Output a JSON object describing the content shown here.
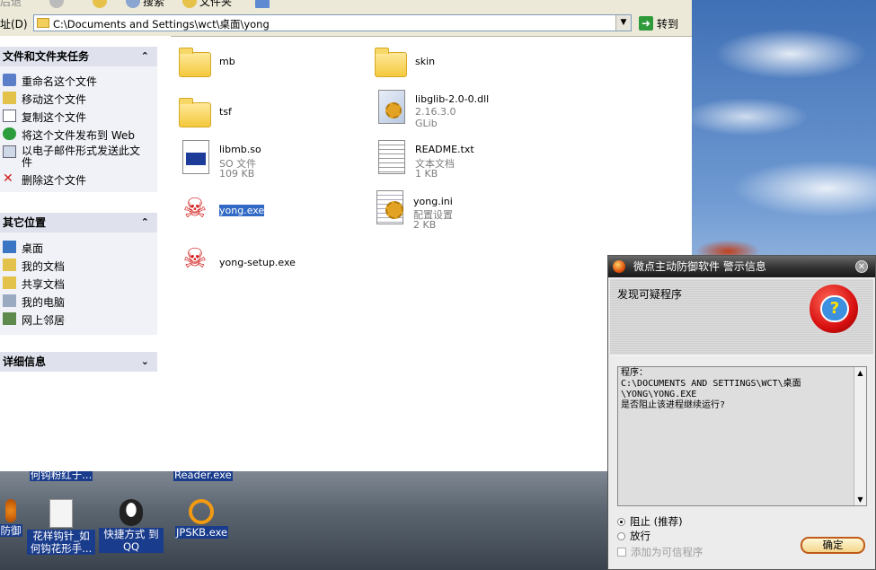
{
  "toolbar": {
    "back": "后退",
    "search": "搜索",
    "folders": "文件夹"
  },
  "address": {
    "label": "址(D)",
    "path": "C:\\Documents and Settings\\wct\\桌面\\yong",
    "go": "转到"
  },
  "taskpane": {
    "file_tasks": {
      "title": "文件和文件夹任务",
      "items": [
        "重命名这个文件",
        "移动这个文件",
        "复制这个文件",
        "将这个文件发布到 Web",
        "以电子邮件形式发送此文件",
        "删除这个文件"
      ]
    },
    "other_places": {
      "title": "其它位置",
      "items": [
        "桌面",
        "我的文档",
        "共享文档",
        "我的电脑",
        "网上邻居"
      ]
    },
    "details": {
      "title": "详细信息"
    }
  },
  "files": [
    {
      "name": "mb",
      "type": "folder"
    },
    {
      "name": "skin",
      "type": "folder"
    },
    {
      "name": "tsf",
      "type": "folder"
    },
    {
      "name": "libglib-2.0-0.dll",
      "line2": "2.16.3.0",
      "line3": "GLib",
      "type": "dll"
    },
    {
      "name": "libmb.so",
      "line2": "SO 文件",
      "line3": "109 KB",
      "type": "so"
    },
    {
      "name": "README.txt",
      "line2": "文本文档",
      "line3": "1 KB",
      "type": "txt"
    },
    {
      "name": "yong.exe",
      "type": "exe",
      "selected": true
    },
    {
      "name": "yong.ini",
      "line2": "配置设置",
      "line3": "2 KB",
      "type": "ini"
    },
    {
      "name": "yong-setup.exe",
      "type": "exe"
    }
  ],
  "desktop_icons": {
    "top_row": [
      "何钩粉红于...",
      "Reader.exe"
    ],
    "bottom_row": [
      "防御",
      "花样钩针_如何钩花形手...",
      "快捷方式 到 QQ",
      "JPSKB.exe"
    ]
  },
  "dialog": {
    "title": "微点主动防御软件   警示信息",
    "heading": "发现可疑程序",
    "body": "程序：\nC:\\DOCUMENTS AND SETTINGS\\WCT\\桌面\n\\YONG\\YONG.EXE\n是否阻止该进程继续运行?",
    "option_block": "阻止 (推荐)",
    "option_allow": "放行",
    "option_trust": "添加为可信程序",
    "ok": "确定"
  },
  "colors": {
    "selection": "#316ac5",
    "taskpane_header": "#dfe2ed",
    "danger": "#d01818"
  }
}
